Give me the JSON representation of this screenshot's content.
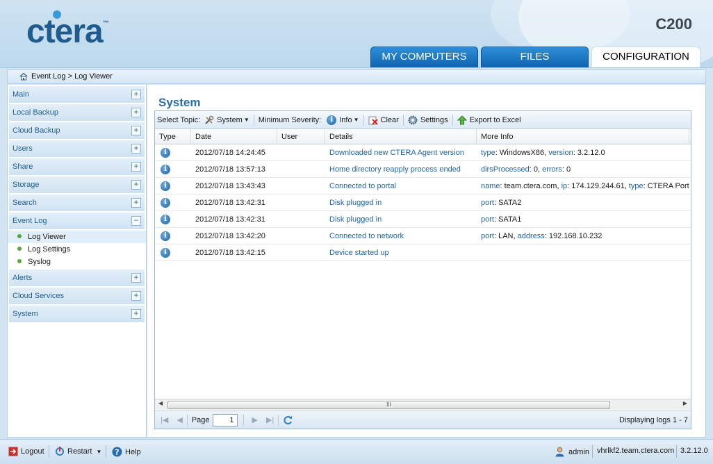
{
  "header": {
    "logo_text": "ctera",
    "logo_tm": "™",
    "model": "C200",
    "tabs": [
      {
        "label": "MY COMPUTERS"
      },
      {
        "label": "FILES"
      },
      {
        "label": "CONFIGURATION"
      }
    ]
  },
  "breadcrumb": "Event Log > Log Viewer",
  "sidebar": {
    "items": [
      {
        "label": "Main",
        "toggle": "+"
      },
      {
        "label": "Local Backup",
        "toggle": "+"
      },
      {
        "label": "Cloud Backup",
        "toggle": "+"
      },
      {
        "label": "Users",
        "toggle": "+"
      },
      {
        "label": "Share",
        "toggle": "+"
      },
      {
        "label": "Storage",
        "toggle": "+"
      },
      {
        "label": "Search",
        "toggle": "+"
      },
      {
        "label": "Event Log",
        "toggle": "−"
      },
      {
        "label": "Alerts",
        "toggle": "+"
      },
      {
        "label": "Cloud Services",
        "toggle": "+"
      },
      {
        "label": "System",
        "toggle": "+"
      }
    ],
    "event_log_sub": [
      {
        "label": "Log Viewer"
      },
      {
        "label": "Log Settings"
      },
      {
        "label": "Syslog"
      }
    ]
  },
  "main": {
    "title": "System",
    "toolbar": {
      "select_topic_label": "Select Topic:",
      "topic_value": "System",
      "min_severity_label": "Minimum Severity:",
      "severity_value": "Info",
      "clear_label": "Clear",
      "settings_label": "Settings",
      "export_label": "Export to Excel"
    },
    "columns": [
      "Type",
      "Date",
      "User",
      "Details",
      "More Info"
    ],
    "rows": [
      {
        "date": "2012/07/18 14:24:45",
        "user": "",
        "details": "Downloaded new CTERA Agent version",
        "more": [
          [
            "type",
            "WindowsX86"
          ],
          [
            "version",
            "3.2.12.0"
          ]
        ]
      },
      {
        "date": "2012/07/18 13:57:13",
        "user": "",
        "details": "Home directory reapply process ended",
        "more": [
          [
            "dirsProcessed",
            "0"
          ],
          [
            "errors",
            "0"
          ]
        ]
      },
      {
        "date": "2012/07/18 13:43:43",
        "user": "",
        "details": "Connected to portal",
        "more": [
          [
            "name",
            "team.ctera.com"
          ],
          [
            "ip",
            "174.129.244.61"
          ],
          [
            "type",
            "CTERA Portal"
          ]
        ]
      },
      {
        "date": "2012/07/18 13:42:31",
        "user": "",
        "details": "Disk plugged in",
        "more": [
          [
            "port",
            "SATA2"
          ]
        ]
      },
      {
        "date": "2012/07/18 13:42:31",
        "user": "",
        "details": "Disk plugged in",
        "more": [
          [
            "port",
            "SATA1"
          ]
        ]
      },
      {
        "date": "2012/07/18 13:42:20",
        "user": "",
        "details": "Connected to network",
        "more": [
          [
            "port",
            "LAN"
          ],
          [
            "address",
            "192.168.10.232"
          ]
        ]
      },
      {
        "date": "2012/07/18 13:42:15",
        "user": "",
        "details": "Device started up",
        "more": []
      }
    ],
    "pager": {
      "page_label": "Page",
      "page_value": "1",
      "display_text": "Displaying logs 1 - 7"
    },
    "scroll_thumb": "III"
  },
  "footer": {
    "logout": "Logout",
    "restart": "Restart",
    "help": "Help",
    "user": "admin",
    "host": "vhrlkf2.team.ctera.com",
    "version": "3.2.12.0"
  },
  "colors": {
    "tab_blue": "#1a73c2",
    "link_blue": "#1f64a6",
    "title_blue": "#2a6da8",
    "info_blue": "#1b5f9d"
  }
}
